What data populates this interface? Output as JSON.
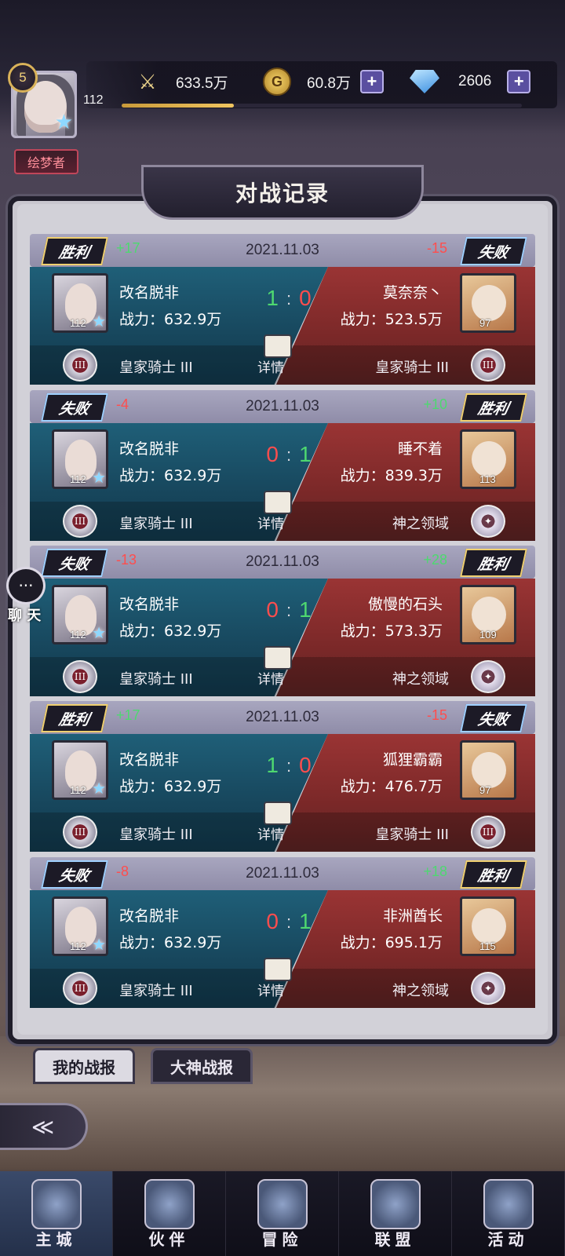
{
  "player": {
    "level": "5",
    "exp": "112",
    "title": "绘梦者",
    "exp_progress": 0.28
  },
  "resources": {
    "power": "633.5万",
    "gold": "60.8万",
    "diamond": "2606"
  },
  "panel_title": "对战记录",
  "records": [
    {
      "date": "2021.11.03",
      "my_result": "胜利",
      "my_pts": "+17",
      "opp_result": "失败",
      "opp_pts": "-15",
      "my_name": "改名脱非",
      "my_power": "战力：632.9万",
      "my_rank": "皇家骑士 III",
      "my_level": "112",
      "score_l": "1",
      "score_r": "0",
      "detail": "详情",
      "opp_name": "莫奈奈丶",
      "opp_power": "战力：523.5万",
      "opp_rank": "皇家骑士 III",
      "opp_level": "97"
    },
    {
      "date": "2021.11.03",
      "my_result": "失败",
      "my_pts": "-4",
      "opp_result": "胜利",
      "opp_pts": "+10",
      "my_name": "改名脱非",
      "my_power": "战力：632.9万",
      "my_rank": "皇家骑士 III",
      "my_level": "112",
      "score_l": "0",
      "score_r": "1",
      "detail": "详情",
      "opp_name": "睡不着",
      "opp_power": "战力：839.3万",
      "opp_rank": "神之领域",
      "opp_level": "113"
    },
    {
      "date": "2021.11.03",
      "my_result": "失败",
      "my_pts": "-13",
      "opp_result": "胜利",
      "opp_pts": "+28",
      "my_name": "改名脱非",
      "my_power": "战力：632.9万",
      "my_rank": "皇家骑士 III",
      "my_level": "112",
      "score_l": "0",
      "score_r": "1",
      "detail": "详情",
      "opp_name": "傲慢的石头",
      "opp_power": "战力：573.3万",
      "opp_rank": "神之领域",
      "opp_level": "109"
    },
    {
      "date": "2021.11.03",
      "my_result": "胜利",
      "my_pts": "+17",
      "opp_result": "失败",
      "opp_pts": "-15",
      "my_name": "改名脱非",
      "my_power": "战力：632.9万",
      "my_rank": "皇家骑士 III",
      "my_level": "112",
      "score_l": "1",
      "score_r": "0",
      "detail": "详情",
      "opp_name": "狐狸霸霸",
      "opp_power": "战力：476.7万",
      "opp_rank": "皇家骑士 III",
      "opp_level": "97"
    },
    {
      "date": "2021.11.03",
      "my_result": "失败",
      "my_pts": "-8",
      "opp_result": "胜利",
      "opp_pts": "+18",
      "my_name": "改名脱非",
      "my_power": "战力：632.9万",
      "my_rank": "皇家骑士 III",
      "my_level": "112",
      "score_l": "0",
      "score_r": "1",
      "detail": "详情",
      "opp_name": "非洲酋长",
      "opp_power": "战力：695.1万",
      "opp_rank": "神之领域",
      "opp_level": "115"
    }
  ],
  "tabs": {
    "mine": "我的战报",
    "gods": "大神战报"
  },
  "chat": {
    "label": "聊 天"
  },
  "nav": [
    "主城",
    "伙伴",
    "冒险",
    "联盟",
    "活动"
  ],
  "colors": {
    "win_green": "#4ed870",
    "lose_red": "#ff4d4d",
    "left_blue": "#1f5f78",
    "right_red": "#9a3434"
  }
}
